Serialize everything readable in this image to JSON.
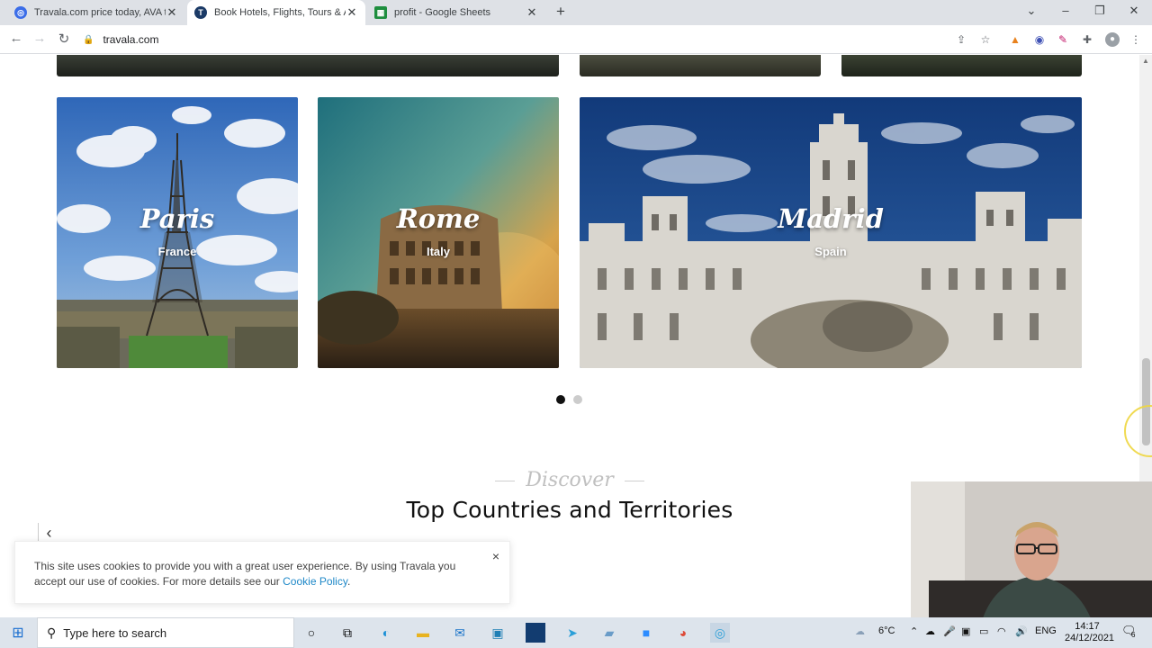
{
  "browser": {
    "tabs": [
      {
        "title": "Travala.com price today, AVA to",
        "favicon_color": "#3b6de8",
        "favicon_icon": "coin-icon",
        "active": false
      },
      {
        "title": "Book Hotels, Flights, Tours & Act",
        "favicon_color": "#1b3a66",
        "favicon_letter": "T",
        "active": true
      },
      {
        "title": "profit - Google Sheets",
        "favicon_color": "#1e8e3e",
        "favicon_icon": "sheets-icon",
        "active": false
      }
    ],
    "new_tab_label": "+",
    "url": "travala.com"
  },
  "page": {
    "destinations": [
      {
        "city": "Paris",
        "country": "France"
      },
      {
        "city": "Rome",
        "country": "Italy"
      },
      {
        "city": "Madrid",
        "country": "Spain"
      }
    ],
    "carousel": {
      "page_count": 2,
      "active_page": 1
    },
    "discover": {
      "kicker": "Discover",
      "title": "Top Countries and Territories"
    },
    "prev_arrow": "‹",
    "cookie_banner": {
      "text_before": "This site uses cookies to provide you with a great user experience. By using Travala you accept our use of cookies. For more details see our ",
      "link_text": "Cookie Policy",
      "text_after": ".",
      "close_label": "×"
    }
  },
  "taskbar": {
    "search_placeholder": "Type here to search",
    "weather": "6°C",
    "language": "ENG",
    "time": "14:17",
    "date": "24/12/2021",
    "notification_count": "6"
  },
  "colors": {
    "accent_link": "#1e88c8",
    "dot_active": "#111111",
    "dot_inactive": "#cccccc"
  }
}
